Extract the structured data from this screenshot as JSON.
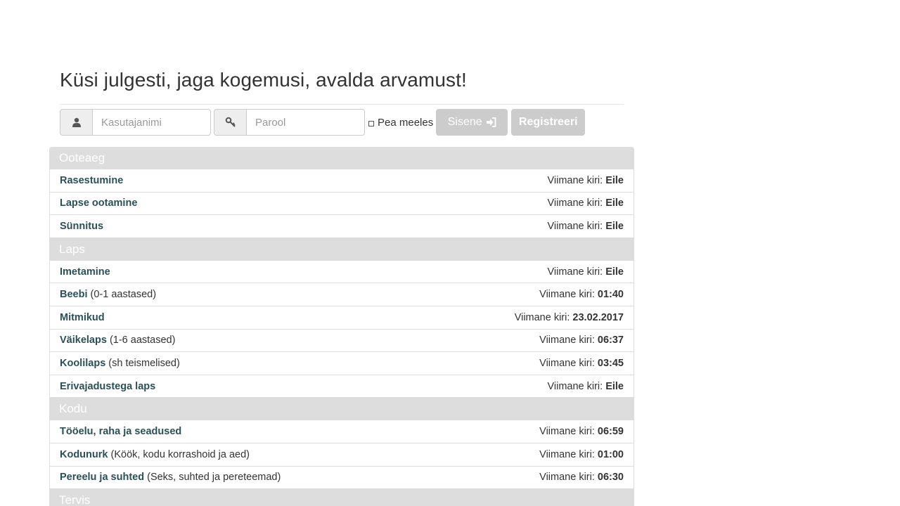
{
  "header": {
    "headline": "Küsi julgesti, jaga kogemusi, avalda arvamust!"
  },
  "login": {
    "username_placeholder": "Kasutajanimi",
    "username_icon": "user-icon",
    "password_placeholder": "Parool",
    "password_icon": "key-icon",
    "remember_label": "Pea meeles",
    "login_button": "Sisene",
    "login_icon": "sign-in-icon",
    "register_button": "Registreeri"
  },
  "last_post_label": "Viimane kiri:",
  "categories": [
    {
      "title": "Ooteaeg",
      "forums": [
        {
          "name": "Rasestumine",
          "sub": "",
          "last": "Eile"
        },
        {
          "name": "Lapse ootamine",
          "sub": "",
          "last": "Eile"
        },
        {
          "name": "Sünnitus",
          "sub": "",
          "last": "Eile"
        }
      ]
    },
    {
      "title": "Laps",
      "forums": [
        {
          "name": "Imetamine",
          "sub": "",
          "last": "Eile"
        },
        {
          "name": "Beebi",
          "sub": "(0-1 aastased)",
          "last": "01:40"
        },
        {
          "name": "Mitmikud",
          "sub": "",
          "last": "23.02.2017"
        },
        {
          "name": "Väikelaps",
          "sub": "(1-6 aastased)",
          "last": "06:37"
        },
        {
          "name": "Koolilaps",
          "sub": "(sh teismelised)",
          "last": "03:45"
        },
        {
          "name": "Erivajadustega laps",
          "sub": "",
          "last": "Eile"
        }
      ]
    },
    {
      "title": "Kodu",
      "forums": [
        {
          "name": "Tööelu, raha ja seadused",
          "sub": "",
          "last": "06:59"
        },
        {
          "name": "Kodunurk",
          "sub": "(Köök, kodu korrashoid ja aed)",
          "last": "01:00"
        },
        {
          "name": "Pereelu ja suhted",
          "sub": "(Seks, suhted ja pereteemad)",
          "last": "06:30"
        }
      ]
    },
    {
      "title": "Tervis",
      "forums": []
    }
  ]
}
